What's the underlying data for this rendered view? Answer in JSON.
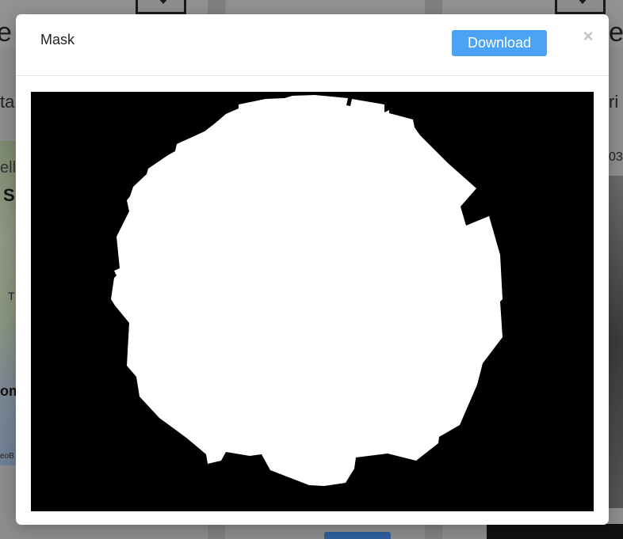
{
  "modal": {
    "title": "Mask",
    "download_label": "Download",
    "close_glyph": "×"
  },
  "mask_image": {
    "background_color": "#000000",
    "foreground_color": "#ffffff"
  },
  "background": {
    "fragments": {
      "e_left": "e c",
      "e_right": "e",
      "ta": "ta",
      "ri": "ri",
      "ell": "ell",
      "s": "S",
      "num_03": "03",
      "t": "T",
      "om": "om",
      "geo": "eoB"
    },
    "icons": [
      "download-icon",
      "download-icon"
    ]
  },
  "colors": {
    "accent": "#4aa3f5",
    "overlay": "#8d8d8d"
  }
}
